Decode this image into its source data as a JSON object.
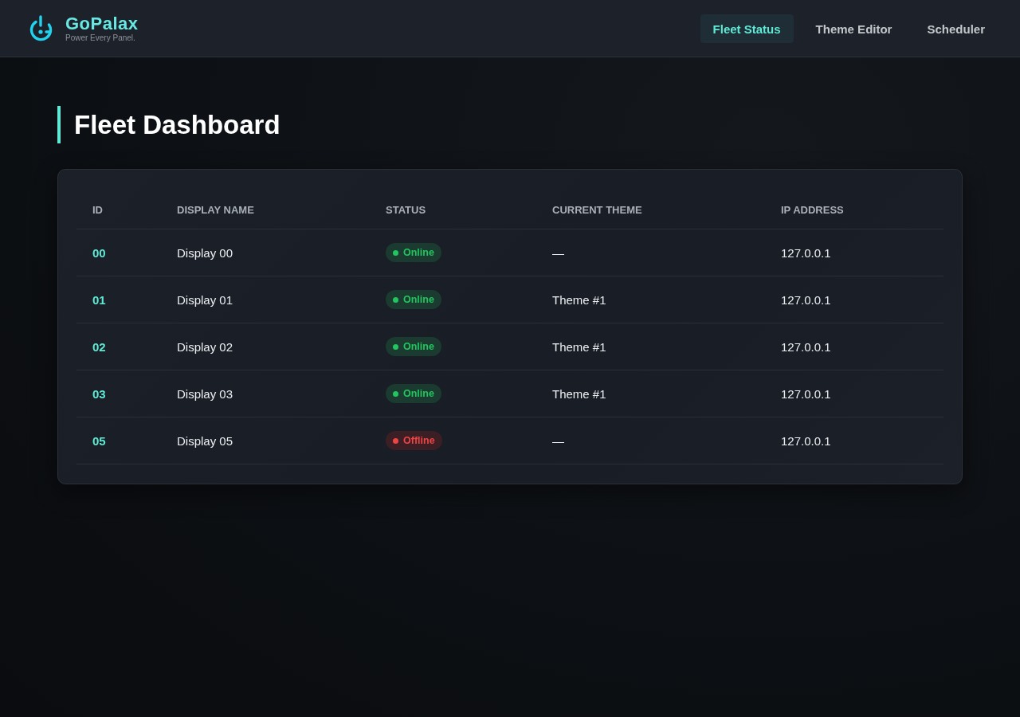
{
  "brand": {
    "name": "GoPalax",
    "tagline": "Power Every Panel."
  },
  "nav": [
    {
      "label": "Fleet Status",
      "selected": true
    },
    {
      "label": "Theme Editor",
      "selected": false
    },
    {
      "label": "Scheduler",
      "selected": false
    }
  ],
  "page": {
    "title": "Fleet Dashboard"
  },
  "table": {
    "columns": [
      "ID",
      "DISPLAY NAME",
      "STATUS",
      "CURRENT THEME",
      "IP ADDRESS"
    ],
    "rows": [
      {
        "id": "00",
        "name": "Display 00",
        "status": {
          "label": "Online",
          "kind": "online"
        },
        "theme": "—",
        "ip": "127.0.0.1"
      },
      {
        "id": "01",
        "name": "Display 01",
        "status": {
          "label": "Online",
          "kind": "online"
        },
        "theme": "Theme #1",
        "ip": "127.0.0.1"
      },
      {
        "id": "02",
        "name": "Display 02",
        "status": {
          "label": "Online",
          "kind": "online"
        },
        "theme": "Theme #1",
        "ip": "127.0.0.1"
      },
      {
        "id": "03",
        "name": "Display 03",
        "status": {
          "label": "Online",
          "kind": "online"
        },
        "theme": "Theme #1",
        "ip": "127.0.0.1"
      },
      {
        "id": "05",
        "name": "Display 05",
        "status": {
          "label": "Offline",
          "kind": "offline"
        },
        "theme": "—",
        "ip": "127.0.0.1"
      }
    ]
  }
}
